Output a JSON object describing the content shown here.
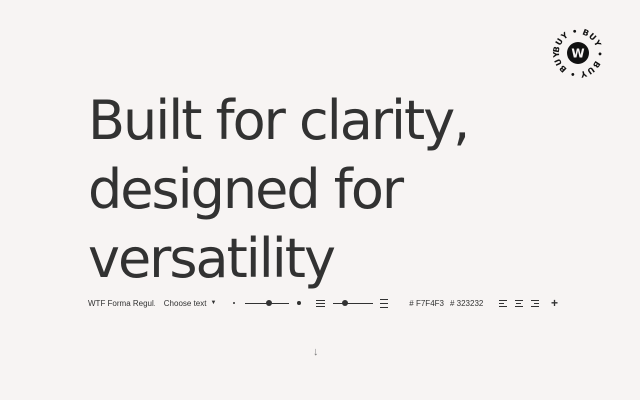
{
  "badge": {
    "ring_text": "BUY • BUY • BUY • BUY •",
    "logo": "W"
  },
  "headline": {
    "line1": "Built for clarity,",
    "line2": "designed for",
    "line3": "versatility"
  },
  "toolbar": {
    "font_name": "WTF Forma Regul...",
    "choose_text": "Choose text",
    "caret_icon": "chevron-down-icon",
    "size_slider_value": 0.55,
    "line_height_slider_value": 0.32,
    "bg_color": "# F7F4F3",
    "text_color": "# 323232",
    "add_icon": "plus-icon"
  },
  "scroll_hint_icon": "arrow-down-icon",
  "colors": {
    "background": "#F7F4F3",
    "text": "#323232"
  }
}
